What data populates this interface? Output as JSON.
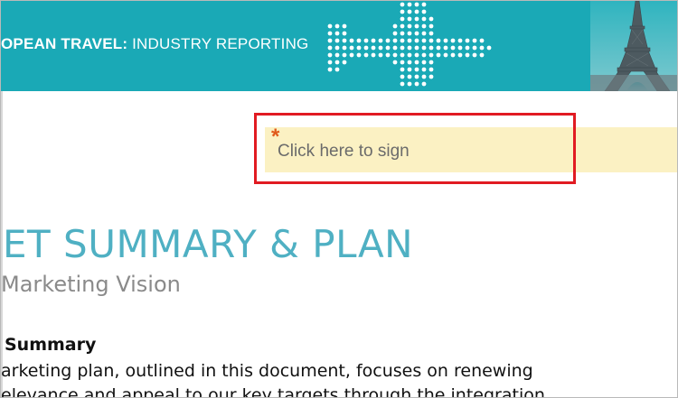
{
  "banner": {
    "title_bold": "OPEAN TRAVEL:",
    "title_rest": " INDUSTRY REPORTING",
    "colors": {
      "background": "#1aa9b6",
      "text": "#ffffff"
    },
    "icons": [
      "dotted-airplane-icon",
      "eiffel-tower-image"
    ]
  },
  "sign_field": {
    "required_mark": "*",
    "label": "Click here to sign",
    "colors": {
      "field": "#fbf1c3",
      "highlight_border": "#e11b22",
      "required": "#e05a1b"
    }
  },
  "document": {
    "heading": "ET SUMMARY & PLAN",
    "subheading": "Marketing Vision",
    "section_heading": "Summary",
    "body_lines": [
      "arketing plan, outlined in this document, focuses on renewing",
      "elevance and appeal to our key targets through the integration"
    ],
    "colors": {
      "heading": "#4fb0c3",
      "subheading": "#8a8a8a"
    }
  }
}
